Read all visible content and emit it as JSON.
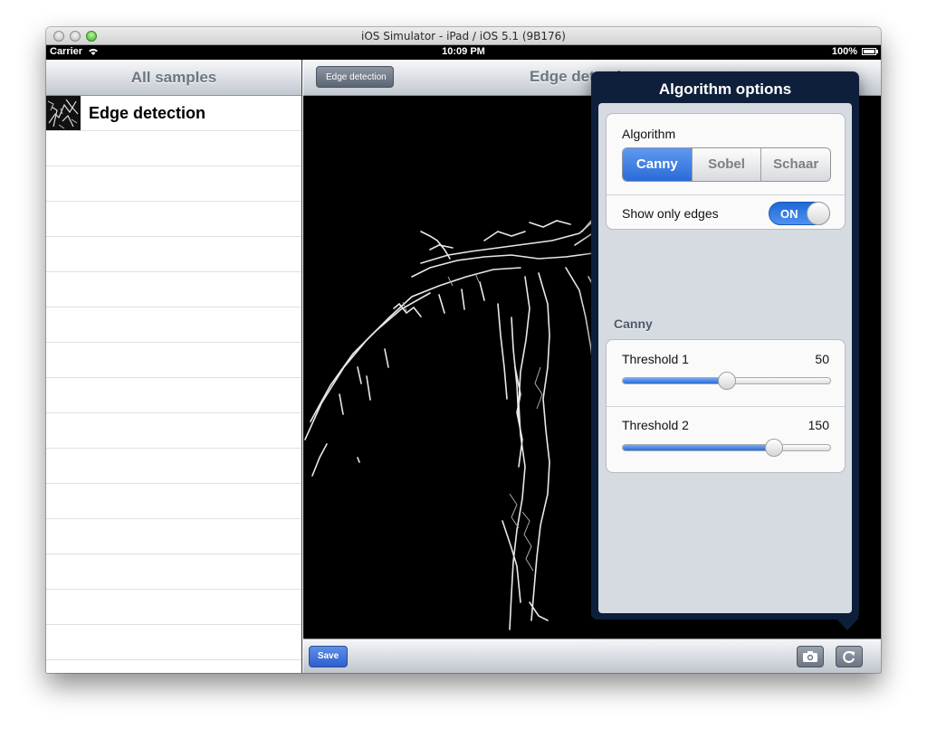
{
  "window": {
    "title": "iOS Simulator - iPad / iOS 5.1 (9B176)"
  },
  "status_bar": {
    "carrier": "Carrier",
    "time": "10:09 PM",
    "battery": "100%"
  },
  "master": {
    "nav_title": "All samples",
    "items": [
      {
        "label": "Edge detection"
      }
    ]
  },
  "detail": {
    "back_label": "Edge detection",
    "nav_title": "Edge detection",
    "toolbar": {
      "save_label": "Save"
    }
  },
  "popover": {
    "title": "Algorithm options",
    "algorithm": {
      "label": "Algorithm",
      "options": [
        "Canny",
        "Sobel",
        "Schaar"
      ],
      "selected": "Canny"
    },
    "show_edges": {
      "label": "Show only edges",
      "state": "ON"
    },
    "section": "Canny",
    "sliders": [
      {
        "label": "Threshold 1",
        "value": "50",
        "fraction": 0.5
      },
      {
        "label": "Threshold 2",
        "value": "150",
        "fraction": 0.73
      }
    ]
  },
  "colors": {
    "accent": "#2a6bd8",
    "popover_frame": "#0e1f3b"
  }
}
